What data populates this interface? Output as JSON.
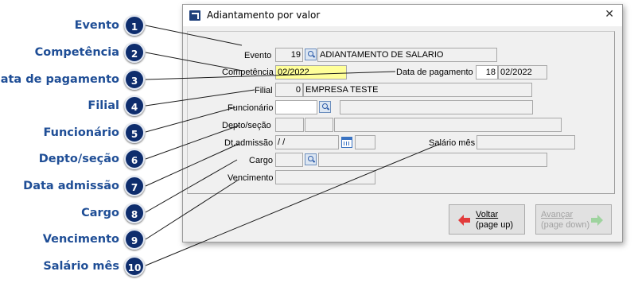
{
  "dialog": {
    "title": "Adiantamento por valor"
  },
  "callouts": [
    {
      "num": "1",
      "label": "Evento"
    },
    {
      "num": "2",
      "label": "Competência"
    },
    {
      "num": "3",
      "label": "Data de pagamento"
    },
    {
      "num": "4",
      "label": "Filial"
    },
    {
      "num": "5",
      "label": "Funcionário"
    },
    {
      "num": "6",
      "label": "Depto/seção"
    },
    {
      "num": "7",
      "label": "Data admissão"
    },
    {
      "num": "8",
      "label": "Cargo"
    },
    {
      "num": "9",
      "label": "Vencimento"
    },
    {
      "num": "10",
      "label": "Salário mês"
    }
  ],
  "form": {
    "evento": {
      "label": "Evento",
      "code": "19",
      "desc": "ADIANTAMENTO DE SALARIO"
    },
    "competencia": {
      "label": "Competência",
      "value": "02/2022"
    },
    "data_pagamento": {
      "label": "Data de pagamento",
      "day": "18",
      "month_year": "02/2022"
    },
    "filial": {
      "label": "Filial",
      "code": "0",
      "desc": "EMPRESA TESTE"
    },
    "funcionario": {
      "label": "Funcionário",
      "code": "",
      "name": ""
    },
    "depto": {
      "label": "Depto/seção",
      "depto": "",
      "secao": "",
      "desc": ""
    },
    "dt_admissao": {
      "label": "Dt.admissão",
      "value": " /  /",
      "extra": ""
    },
    "salario_mes": {
      "label": "Salário mês",
      "value": ""
    },
    "cargo": {
      "label": "Cargo",
      "code": "",
      "desc": ""
    },
    "vencimento": {
      "label": "Vencimento",
      "value": ""
    }
  },
  "buttons": {
    "voltar": {
      "line1": "Voltar",
      "line2": "(page up)"
    },
    "avancar": {
      "line1": "Avançar",
      "line2": "(page down)"
    }
  },
  "colors": {
    "callout_text": "#1f4e96",
    "badge": "#0e2d6d",
    "highlight": "#ffff99"
  },
  "icons": [
    "app-icon",
    "close-icon",
    "search-icon",
    "calendar-icon",
    "arrow-left-icon",
    "arrow-right-icon"
  ]
}
